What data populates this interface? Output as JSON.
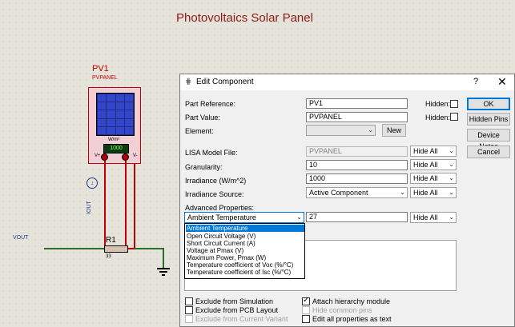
{
  "schematic": {
    "title": "Photovoltaics Solar Panel",
    "pv_ref": "PV1",
    "pv_type": "PVPANEL",
    "meter_unit": "W/m²",
    "meter_value": "1000",
    "vplus": "V+",
    "vminus": "V-",
    "iout": "IOUT",
    "vout": "VOUT",
    "resistor_ref": "R1",
    "resistor_value": "33"
  },
  "dialog": {
    "title": "Edit Component",
    "help": "?",
    "close": "✕",
    "part_reference_label": "Part Reference:",
    "part_reference_value": "PV1",
    "part_value_label": "Part Value:",
    "part_value_value": "PVPANEL",
    "element_label": "Element:",
    "new_button": "New",
    "hidden_label": "Hidden:",
    "rows": [
      {
        "label": "LISA Model File:",
        "value": "PVPANEL",
        "vis": "Hide All"
      },
      {
        "label": "Granularity:",
        "value": "10",
        "vis": "Hide All"
      },
      {
        "label": "Irradiance (W/m^2)",
        "value": "1000",
        "vis": "Hide All"
      },
      {
        "label": "Irradiance Source:",
        "value": "Active Component",
        "vis": "Hide All"
      }
    ],
    "advanced_label": "Advanced Properties:",
    "advanced_selected": "Ambient Temperature",
    "advanced_value": "27",
    "advanced_vis": "Hide All",
    "dropdown_options": [
      "Ambient Temperature",
      "Open Circuit Voltage (V)",
      "Short Circuit Current (A)",
      "Voltage at Pmax (V)",
      "Maximum Power, Pmax (W)",
      "Temperature coefficient of Voc (%/°C)",
      "Temperature coefficient of Isc (%/°C)"
    ],
    "checkboxes": {
      "exclude_simulation": "Exclude from Simulation",
      "exclude_pcb": "Exclude from PCB Layout",
      "exclude_variant": "Exclude from Current Variant",
      "attach_hierarchy": "Attach hierarchy module",
      "hide_common_pins": "Hide common pins",
      "edit_all_props": "Edit all properties as text"
    },
    "buttons": {
      "ok": "OK",
      "hidden_pins": "Hidden Pins",
      "device_notes": "Device Notes",
      "cancel": "Cancel"
    }
  }
}
